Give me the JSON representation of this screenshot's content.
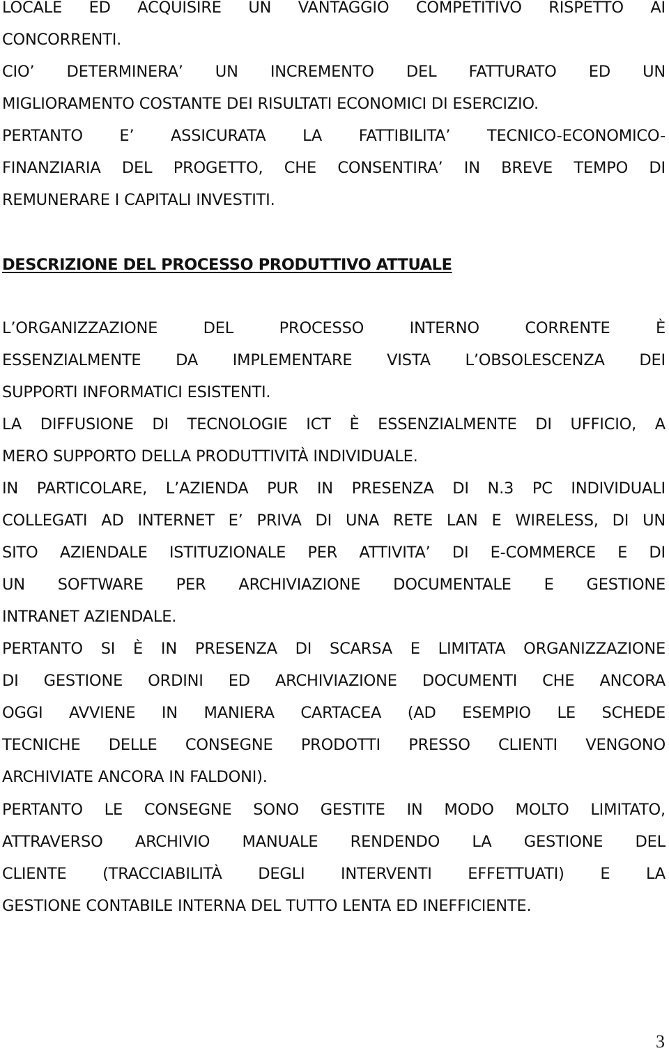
{
  "document": {
    "paragraphs_before_heading": [
      {
        "lines": [
          "LOCALE ED ACQUISIRE UN VANTAGGIO COMPETITIVO RISPETTO AI",
          "CONCORRENTI."
        ]
      },
      {
        "lines": [
          "CIO’ DETERMINERA’ UN INCREMENTO DEL FATTURATO ED UN",
          "MIGLIORAMENTO COSTANTE DEI RISULTATI ECONOMICI DI ESERCIZIO."
        ]
      },
      {
        "lines": [
          "PERTANTO E’ ASSICURATA LA FATTIBILITA’ TECNICO-ECONOMICO-",
          "FINANZIARIA DEL PROGETTO, CHE CONSENTIRA’ IN BREVE TEMPO DI",
          "REMUNERARE I CAPITALI INVESTITI."
        ]
      }
    ],
    "section_heading": "DESCRIZIONE DEL PROCESSO PRODUTTIVO ATTUALE",
    "paragraphs_after_heading": [
      {
        "lines": [
          "L’ORGANIZZAZIONE DEL PROCESSO INTERNO CORRENTE È",
          "ESSENZIALMENTE DA IMPLEMENTARE VISTA L’OBSOLESCENZA DEI",
          "SUPPORTI INFORMATICI ESISTENTI."
        ]
      },
      {
        "lines": [
          "LA DIFFUSIONE DI TECNOLOGIE ICT È ESSENZIALMENTE DI UFFICIO, A",
          "MERO SUPPORTO DELLA PRODUTTIVITÀ INDIVIDUALE."
        ]
      },
      {
        "lines": [
          "IN PARTICOLARE, L’AZIENDA PUR IN PRESENZA DI N.3 PC INDIVIDUALI",
          "COLLEGATI AD INTERNET E’ PRIVA DI UNA RETE LAN E WIRELESS, DI UN",
          "SITO AZIENDALE ISTITUZIONALE PER ATTIVITA’ DI E-COMMERCE E DI",
          "UN SOFTWARE PER ARCHIVIAZIONE DOCUMENTALE E GESTIONE",
          "INTRANET AZIENDALE."
        ]
      },
      {
        "lines": [
          "PERTANTO SI È IN PRESENZA DI SCARSA E LIMITATA ORGANIZZAZIONE",
          "DI GESTIONE ORDINI ED ARCHIVIAZIONE DOCUMENTI CHE ANCORA",
          "OGGI AVVIENE IN MANIERA CARTACEA (AD ESEMPIO LE SCHEDE",
          "TECNICHE DELLE CONSEGNE PRODOTTI PRESSO CLIENTI VENGONO",
          "ARCHIVIATE ANCORA IN FALDONI)."
        ]
      },
      {
        "lines": [
          "PERTANTO LE CONSEGNE SONO GESTITE IN MODO MOLTO LIMITATO,",
          "ATTRAVERSO ARCHIVIO MANUALE RENDENDO LA GESTIONE DEL",
          "CLIENTE (TRACCIABILITÀ DEGLI INTERVENTI EFFETTUATI) E LA",
          "GESTIONE CONTABILE INTERNA DEL TUTTO LENTA ED INEFFICIENTE."
        ]
      }
    ],
    "page_number": "3"
  }
}
